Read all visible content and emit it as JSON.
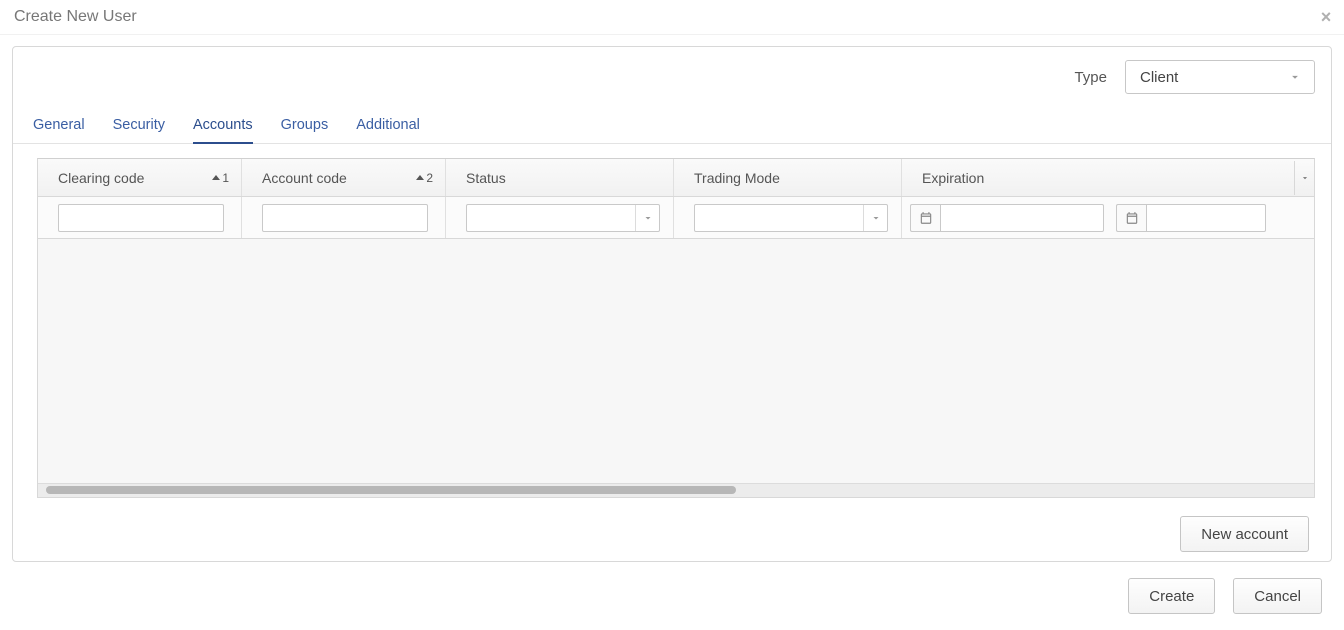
{
  "header": {
    "title": "Create New User"
  },
  "type": {
    "label": "Type",
    "value": "Client"
  },
  "tabs": [
    {
      "label": "General",
      "active": false
    },
    {
      "label": "Security",
      "active": false
    },
    {
      "label": "Accounts",
      "active": true
    },
    {
      "label": "Groups",
      "active": false
    },
    {
      "label": "Additional",
      "active": false
    }
  ],
  "grid": {
    "columns": [
      {
        "label": "Clearing code",
        "sort_order": "1"
      },
      {
        "label": "Account code",
        "sort_order": "2"
      },
      {
        "label": "Status"
      },
      {
        "label": "Trading Mode"
      },
      {
        "label": "Expiration"
      }
    ],
    "filters": {
      "clearing_code": "",
      "account_code": "",
      "status": "",
      "trading_mode": "",
      "expiration_from": "",
      "expiration_to": ""
    },
    "rows": []
  },
  "panel_actions": {
    "new_account": "New account"
  },
  "footer": {
    "create": "Create",
    "cancel": "Cancel"
  }
}
